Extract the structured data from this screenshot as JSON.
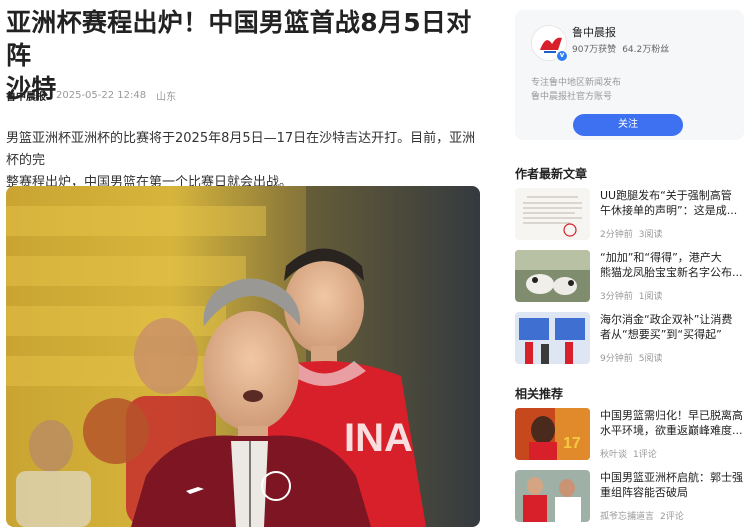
{
  "article": {
    "title_line1": "亚洲杯赛程出炉！中国男篮首战8月5日对阵",
    "title_line2": "沙特",
    "author": "鲁中晨报",
    "date": "2025-05-22 12:48",
    "location": "山东",
    "lead_line1": "男篮亚洲杯亚洲杯的比赛将于2025年8月5日—17日在沙特吉达开打。目前，亚洲杯的完",
    "lead_line2": "整赛程出炉，中国男篮在第一个比赛日就会出战。"
  },
  "author_card": {
    "name": "鲁中晨报",
    "fans_likes": "907万获赞",
    "followers": "64.2万粉丝",
    "desc_line1": "专注鲁中地区新闻发布",
    "desc_line2": "鲁中晨报社官方账号",
    "follow_label": "关注",
    "verify_mark": "v"
  },
  "latest": {
    "heading": "作者最新文章",
    "items": [
      {
        "line1": "UU跑腿发布“关于强制高管",
        "line2": "午休接单的声明”：这是成...",
        "time": "2分钟前",
        "reads": "3阅读"
      },
      {
        "line1": "“加加”和“得得”，港产大",
        "line2": "熊猫龙凤胎宝宝新名字公布...",
        "time": "3分钟前",
        "reads": "1阅读"
      },
      {
        "line1": "海尔消金“政企双补”让消费",
        "line2": "者从“想要买”到“买得起”",
        "time": "9分钟前",
        "reads": "5阅读"
      }
    ]
  },
  "related": {
    "heading": "相关推荐",
    "items": [
      {
        "line1": "中国男篮需归化！早已脱离高",
        "line2": "水平环境，欲重返巅峰难度...",
        "source": "秋叶谈",
        "comments": "1评论"
      },
      {
        "line1": "中国男篮亚洲杯启航：郭士强",
        "line2": "重组阵容能否破局",
        "source": "孤爷忘捕道言",
        "comments": "2评论"
      }
    ]
  },
  "colors": {
    "accent": "#3d71f2",
    "jersey_red": "#d8202a",
    "coach_maroon": "#7e1523"
  }
}
